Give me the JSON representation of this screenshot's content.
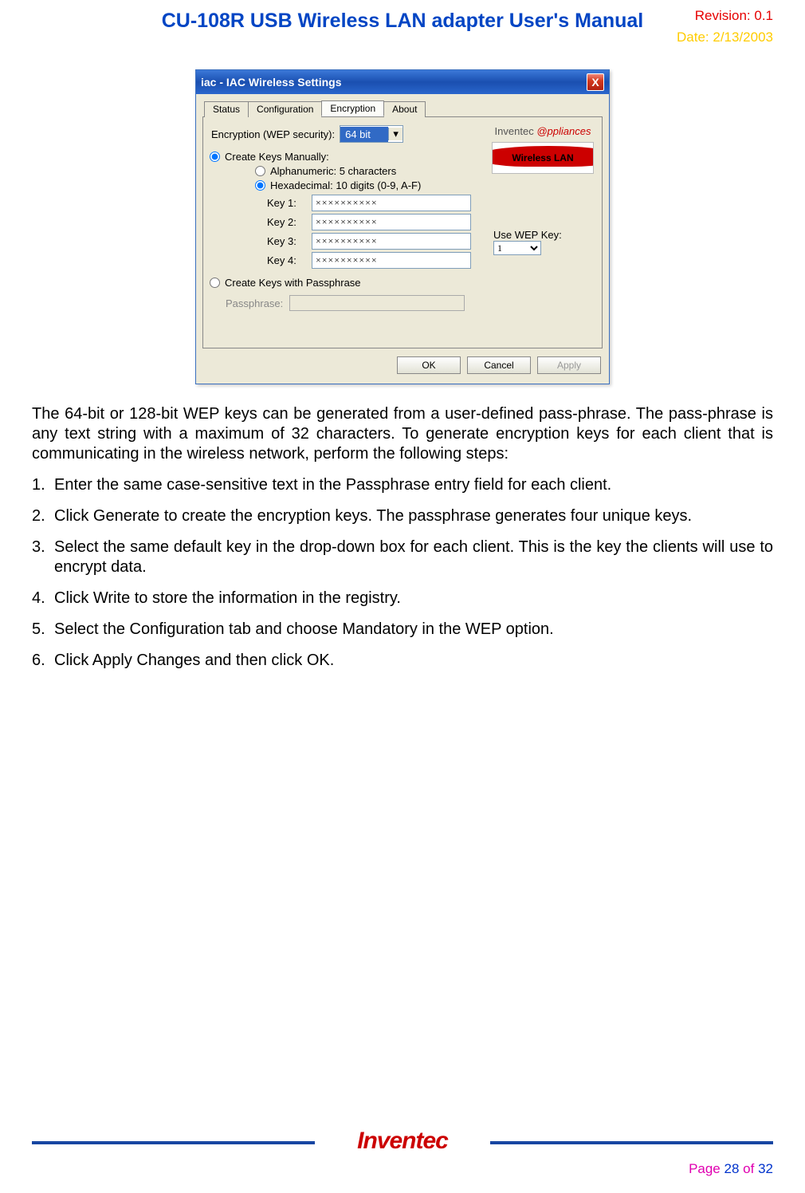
{
  "header": {
    "revision": "Revision: 0.1",
    "title": "CU-108R USB Wireless LAN adapter User's Manual",
    "date": "Date: 2/13/2003"
  },
  "dialog": {
    "titlebar": "iac - IAC Wireless Settings",
    "close": "X",
    "tabs": {
      "status": "Status",
      "config": "Configuration",
      "encryption": "Encryption",
      "about": "About"
    },
    "encryption_label": "Encryption (WEP security):",
    "encryption_value": "64 bit",
    "brand_line1_a": "Inventec",
    "brand_line1_b": "@ppliances",
    "brand_wireless": "Wireless LAN",
    "create_manually": "Create Keys Manually:",
    "alpha_label": "Alphanumeric: 5 characters",
    "hex_label": "Hexadecimal: 10 digits (0-9, A-F)",
    "keylabels": {
      "k1": "Key 1:",
      "k2": "Key 2:",
      "k3": "Key 3:",
      "k4": "Key 4:"
    },
    "keyvals": {
      "k1": "××××××××××",
      "k2": "××××××××××",
      "k3": "××××××××××",
      "k4": "××××××××××"
    },
    "use_wep_label": "Use WEP Key:",
    "use_wep_value": "1",
    "create_passphrase": "Create Keys with Passphrase",
    "passphrase_label": "Passphrase:",
    "buttons": {
      "ok": "OK",
      "cancel": "Cancel",
      "apply": "Apply"
    }
  },
  "body": {
    "para1": "The 64-bit or 128-bit WEP keys can be generated from a user-defined pass-phrase. The pass-phrase is any text string with a maximum of 32 characters. To generate encryption keys for each client that is communicating in the wireless network, perform the following steps:",
    "steps": [
      "Enter the same case-sensitive text in the Passphrase entry field for each client.",
      "Click Generate to create the encryption keys. The passphrase generates four unique keys.",
      "Select the same default key in the drop-down box for each client. This is the key the clients will use to encrypt data.",
      "Click Write to store the information in the registry.",
      "Select the Configuration tab and choose Mandatory in the WEP option.",
      "Click Apply Changes and then click OK."
    ]
  },
  "footer": {
    "logo": "Inventec",
    "page_word": "Page",
    "page_cur": "28",
    "page_of": "of",
    "page_total": "32"
  }
}
